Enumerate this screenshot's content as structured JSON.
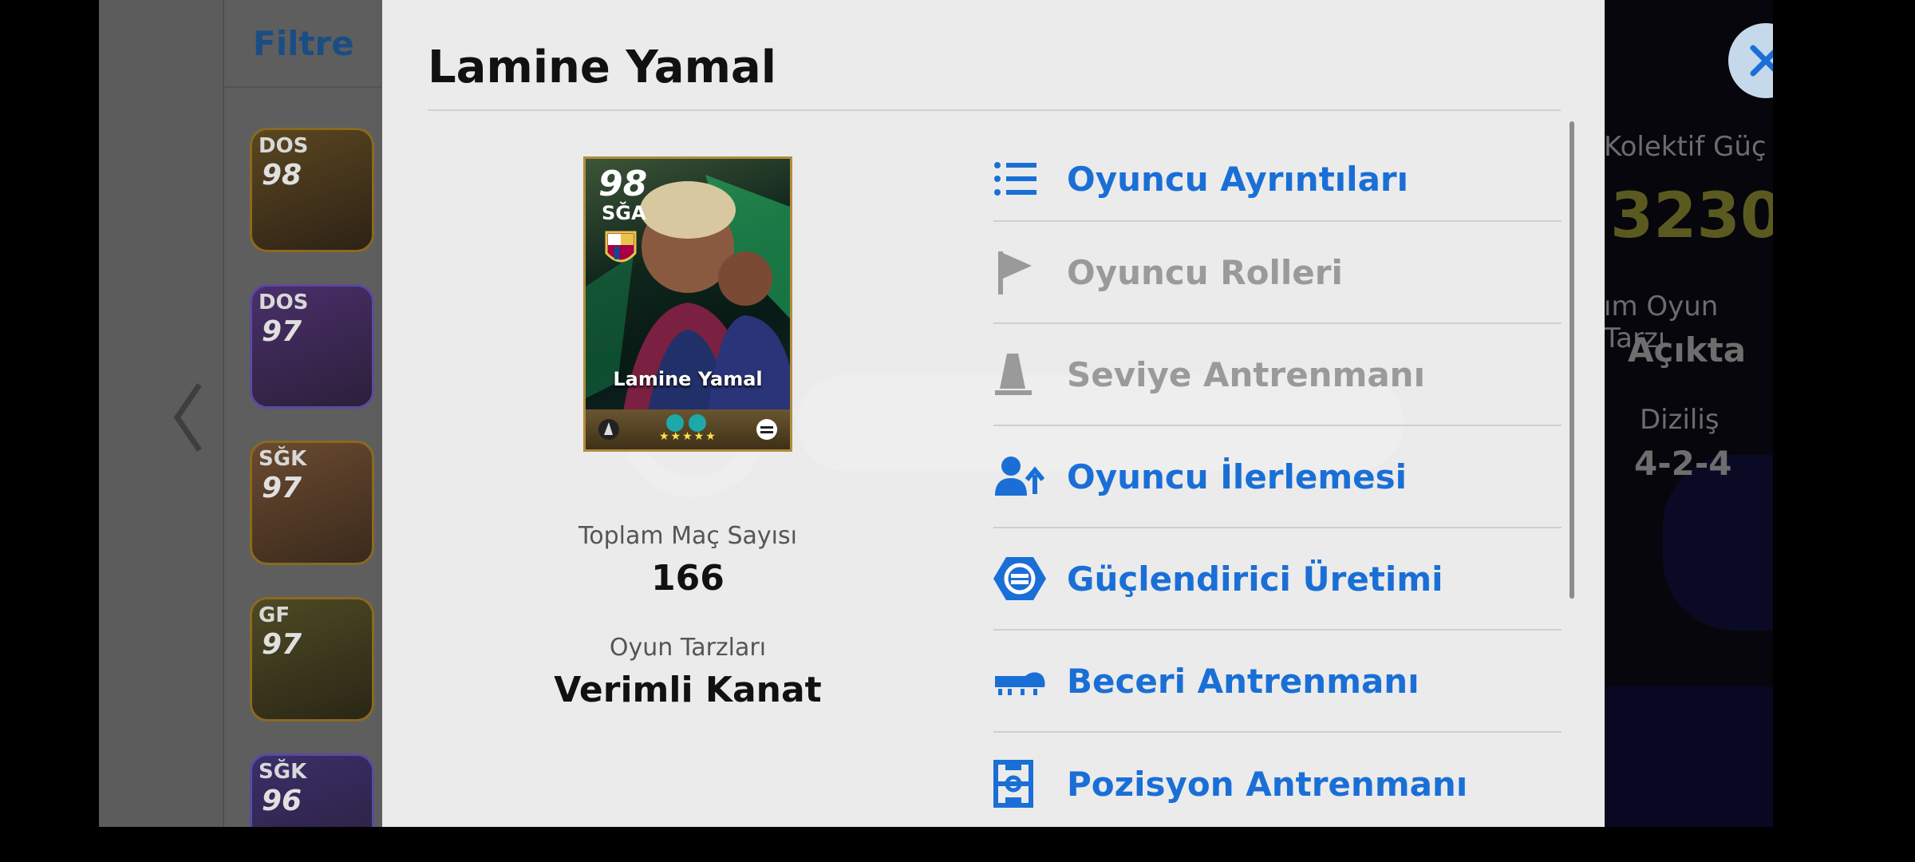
{
  "background": {
    "filter_label": "Filtre",
    "cards": [
      {
        "position": "DOS",
        "rating": "98"
      },
      {
        "position": "DOS",
        "rating": "97"
      },
      {
        "position": "SĞK",
        "rating": "97"
      },
      {
        "position": "GF",
        "rating": "97"
      },
      {
        "position": "SĞK",
        "rating": "96"
      }
    ],
    "stats": {
      "team_strength_label": "Kolektif Güç",
      "team_strength_value": "3230",
      "team_playstyle_label": "ım Oyun Tarzı",
      "team_playstyle_value": "Açıkta",
      "formation_label": "Diziliş",
      "formation_value": "4-2-4"
    }
  },
  "modal": {
    "title": "Lamine Yamal",
    "card": {
      "rating": "98",
      "position": "SĞA",
      "name": "Lamine Yamal"
    },
    "total_matches_label": "Toplam Maç Sayısı",
    "total_matches_value": "166",
    "playstyles_label": "Oyun Tarzları",
    "playstyles_value": "Verimli Kanat",
    "menu": [
      {
        "label": "Oyuncu Ayrıntıları",
        "icon": "list-icon",
        "enabled": true
      },
      {
        "label": "Oyuncu Rolleri",
        "icon": "flag-icon",
        "enabled": false
      },
      {
        "label": "Seviye Antrenmanı",
        "icon": "cone-icon",
        "enabled": false
      },
      {
        "label": "Oyuncu İlerlemesi",
        "icon": "player-progress-icon",
        "enabled": true
      },
      {
        "label": "Güçlendirici Üretimi",
        "icon": "booster-icon",
        "enabled": true
      },
      {
        "label": "Beceri Antrenmanı",
        "icon": "boot-icon",
        "enabled": true
      },
      {
        "label": "Pozisyon Antrenmanı",
        "icon": "pitch-icon",
        "enabled": true
      }
    ]
  },
  "colors": {
    "accent": "#1a6fd6",
    "disabled": "#9a9a9a",
    "modal_bg": "#ebebeb"
  }
}
